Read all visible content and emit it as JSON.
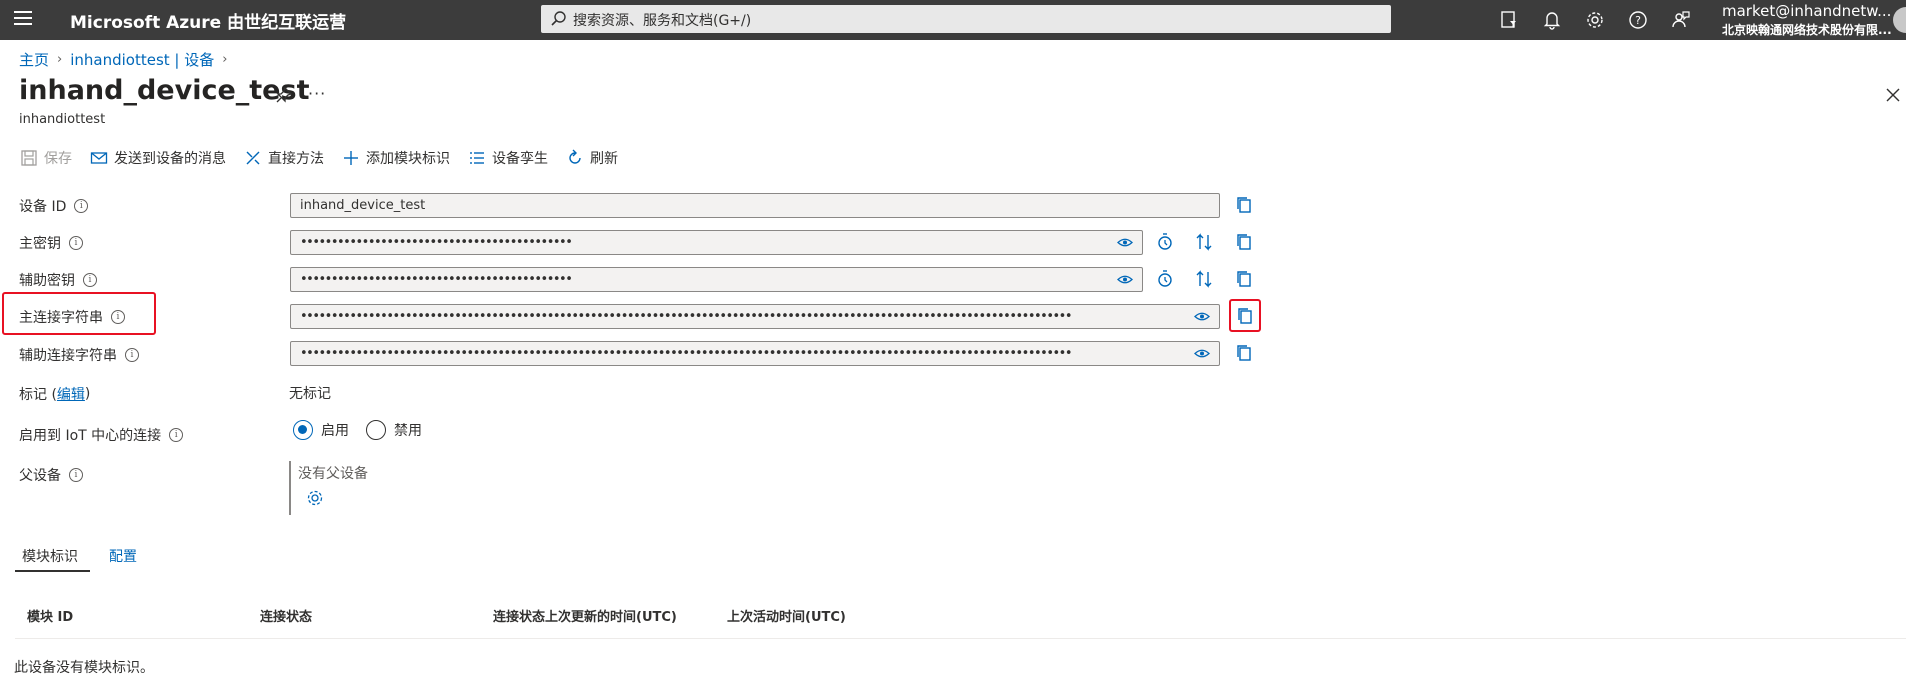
{
  "topbar": {
    "brand": "Microsoft Azure 由世纪互联运营",
    "search_placeholder": "搜索资源、服务和文档(G+/)",
    "account_email": "market@inhandnetw...",
    "account_org": "北京映翰通网络技术股份有限..."
  },
  "breadcrumb": {
    "home": "主页",
    "hub": "inhandiottest | 设备"
  },
  "page": {
    "title": "inhand_device_test",
    "subtitle": "inhandiottest",
    "more": "···"
  },
  "toolbar": {
    "save": "保存",
    "send_message": "发送到设备的消息",
    "direct_method": "直接方法",
    "add_module": "添加模块标识",
    "device_twin": "设备孪生",
    "refresh": "刷新"
  },
  "form": {
    "device_id_label": "设备 ID",
    "device_id_value": "inhand_device_test",
    "primary_key_label": "主密钥",
    "primary_key_value": "••••••••••••••••••••••••••••••••••••••••••••",
    "secondary_key_label": "辅助密钥",
    "secondary_key_value": "••••••••••••••••••••••••••••••••••••••••••••",
    "primary_conn_label": "主连接字符串",
    "primary_conn_value": "•••••••••••••••••••••••••••••••••••••••••••••••••••••••••••••••••••••••••••••••••••••••••••••••••••••••••••••••••••••••••••••",
    "secondary_conn_label": "辅助连接字符串",
    "secondary_conn_value": "•••••••••••••••••••••••••••••••••••••••••••••••••••••••••••••••••••••••••••••••••••••••••••••••••••••••••••••••••••••••••••••",
    "tags_label": "标记 (",
    "tags_edit": "编辑",
    "tags_close": ")",
    "tags_value": "无标记",
    "enable_label": "启用到 IoT 中心的连接",
    "enable_on": "启用",
    "enable_off": "禁用",
    "enable_selected": "启用",
    "parent_label": "父设备",
    "parent_value": "没有父设备"
  },
  "tabs": {
    "modules": "模块标识",
    "config": "配置"
  },
  "table": {
    "columns": [
      "模块 ID",
      "连接状态",
      "连接状态上次更新的时间(UTC)",
      "上次活动时间(UTC)"
    ],
    "empty": "此设备没有模块标识。"
  },
  "colors": {
    "topbar": "#3c3c3c",
    "accent": "#0067b8",
    "highlight": "#e81123"
  }
}
